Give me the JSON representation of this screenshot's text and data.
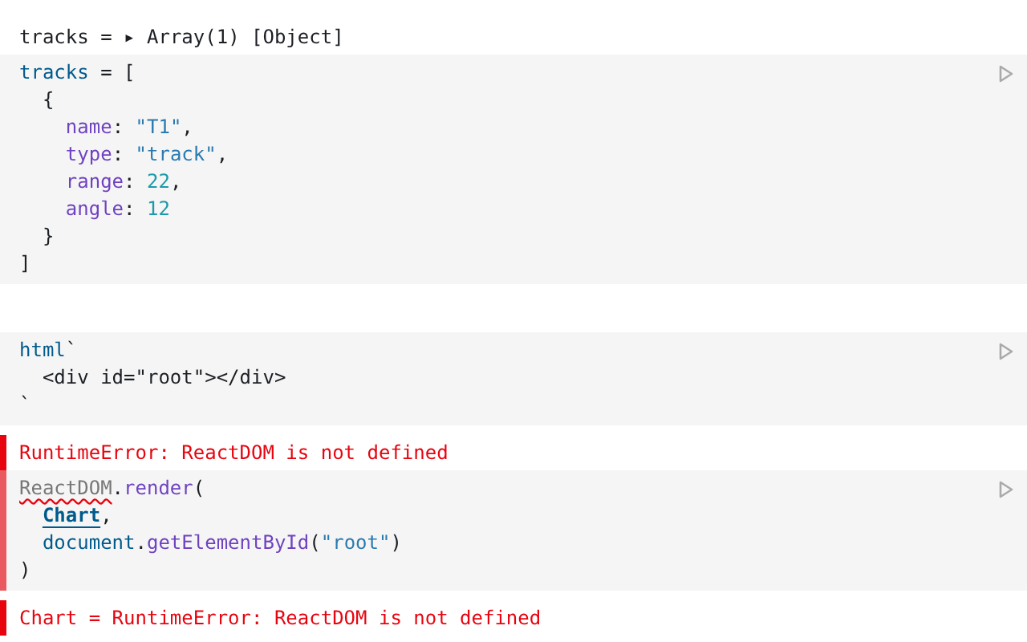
{
  "cells": [
    {
      "output": [
        {
          "text": "tracks = "
        },
        {
          "text": "▸"
        },
        {
          "text": " Array(1) [Object]"
        }
      ],
      "errored": false,
      "lines": [
        [
          {
            "text": "tracks",
            "kind": "var"
          },
          {
            "text": " = [",
            "kind": "plain"
          }
        ],
        [
          {
            "text": "  {",
            "kind": "plain"
          }
        ],
        [
          {
            "text": "    name",
            "kind": "prop"
          },
          {
            "text": ": ",
            "kind": "plain"
          },
          {
            "text": "\"T1\"",
            "kind": "string"
          },
          {
            "text": ",",
            "kind": "plain"
          }
        ],
        [
          {
            "text": "    type",
            "kind": "prop"
          },
          {
            "text": ": ",
            "kind": "plain"
          },
          {
            "text": "\"track\"",
            "kind": "string"
          },
          {
            "text": ",",
            "kind": "plain"
          }
        ],
        [
          {
            "text": "    range",
            "kind": "prop"
          },
          {
            "text": ": ",
            "kind": "plain"
          },
          {
            "text": "22",
            "kind": "number"
          },
          {
            "text": ",",
            "kind": "plain"
          }
        ],
        [
          {
            "text": "    angle",
            "kind": "prop"
          },
          {
            "text": ": ",
            "kind": "plain"
          },
          {
            "text": "12",
            "kind": "number"
          }
        ],
        [
          {
            "text": "  }",
            "kind": "plain"
          }
        ],
        [
          {
            "text": "]",
            "kind": "plain"
          }
        ]
      ]
    },
    {
      "errored": false,
      "lines": [
        [
          {
            "text": "html",
            "kind": "var"
          },
          {
            "text": "`",
            "kind": "plain"
          }
        ],
        [
          {
            "text": "  <div id=\"root\"></div>",
            "kind": "plain"
          }
        ],
        [
          {
            "text": "`",
            "kind": "plain"
          }
        ]
      ]
    },
    {
      "output": [
        {
          "text": "RuntimeError: ReactDOM is not defined"
        }
      ],
      "errored": true,
      "lines": [
        [
          {
            "text": "ReactDOM",
            "kind": "undefined"
          },
          {
            "text": ".",
            "kind": "plain"
          },
          {
            "text": "render",
            "kind": "func"
          },
          {
            "text": "(",
            "kind": "plain"
          }
        ],
        [
          {
            "text": "  Chart",
            "kind": "ref"
          },
          {
            "text": ",",
            "kind": "plain"
          }
        ],
        [
          {
            "text": "  document",
            "kind": "var"
          },
          {
            "text": ".",
            "kind": "plain"
          },
          {
            "text": "getElementById",
            "kind": "func"
          },
          {
            "text": "(",
            "kind": "plain"
          },
          {
            "text": "\"root\"",
            "kind": "string"
          },
          {
            "text": ")",
            "kind": "plain"
          }
        ],
        [
          {
            "text": ")",
            "kind": "plain"
          }
        ]
      ]
    },
    {
      "output": [
        {
          "text": "Chart = RuntimeError: ReactDOM is not defined"
        }
      ],
      "errored": true
    }
  ]
}
